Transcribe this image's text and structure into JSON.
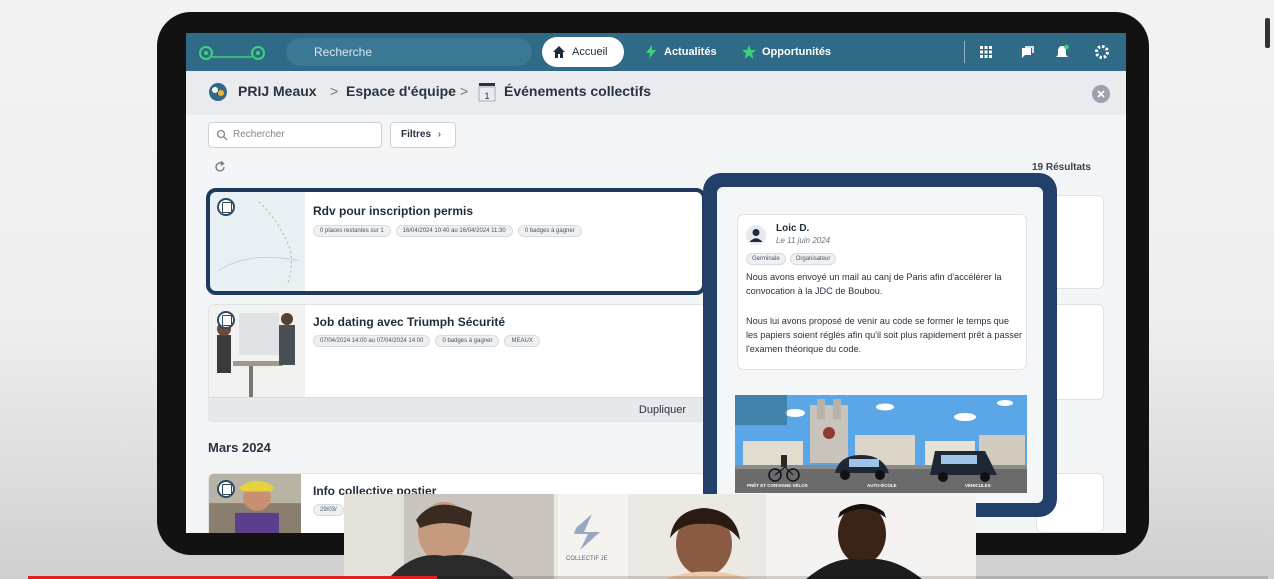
{
  "topbar": {
    "search_label": "Recherche",
    "nav": [
      {
        "label": "Accueil",
        "icon": "home-icon",
        "active": true
      },
      {
        "label": "Actualités",
        "icon": "lightning-icon",
        "active": false
      },
      {
        "label": "Opportunités",
        "icon": "star-icon",
        "active": false
      }
    ],
    "right_icons": [
      "apps-grid-icon",
      "chat-icon",
      "bell-icon",
      "gear-icon"
    ]
  },
  "breadcrumb": {
    "org": "PRIJ Meaux",
    "sep": ">",
    "space": "Espace d'équipe",
    "page": "Événements collectifs",
    "cal_number": "1"
  },
  "toolbar": {
    "search_placeholder": "Rechercher",
    "filters_label": "Filtres",
    "results": "19 Résultats"
  },
  "events": [
    {
      "title": "Rdv pour inscription permis",
      "chips": [
        "0 places restantes sur 1",
        "16/04/2024 10:40 au 16/04/2024 11:30",
        "0 badges à gagner"
      ]
    },
    {
      "title": "Job dating avec Triumph Sécurité",
      "chips": [
        "07/04/2024 14:00 au 07/04/2024 14:00",
        "0 badges à gagner",
        "MEAUX"
      ],
      "action": "Dupliquer"
    }
  ],
  "section": "Mars 2024",
  "events_march": [
    {
      "title": "Info collective postier",
      "chips": [
        "29/03/"
      ]
    }
  ],
  "comment": {
    "author": "Loic D.",
    "date": "Le 11 juin 2024",
    "tags": [
      "Germinale",
      "Organisateur"
    ],
    "paragraph1": "Nous avons envoyé un mail au canj de Paris afin d'accélérer la convocation à la JDC de Boubou.",
    "paragraph2": "Nous lui avons proposé de venir au code se former le temps que les papiers soient réglés afin qu'il soit plus rapidement prêt à passer l'examen théorique du code."
  },
  "illustration": {
    "labels": [
      "PRÊT ET CONVIGNE VÉLOS",
      "AUTO-ÉCOLE",
      "VÉHICULES"
    ]
  },
  "webcam": {
    "logo_text": "COLLECTIF JE"
  },
  "video": {
    "progress": 0.33
  },
  "colors": {
    "topbar": "#2f6a86",
    "popup_border": "#23406a",
    "highlight": "#1e3a5c",
    "progress": "#e02020"
  }
}
